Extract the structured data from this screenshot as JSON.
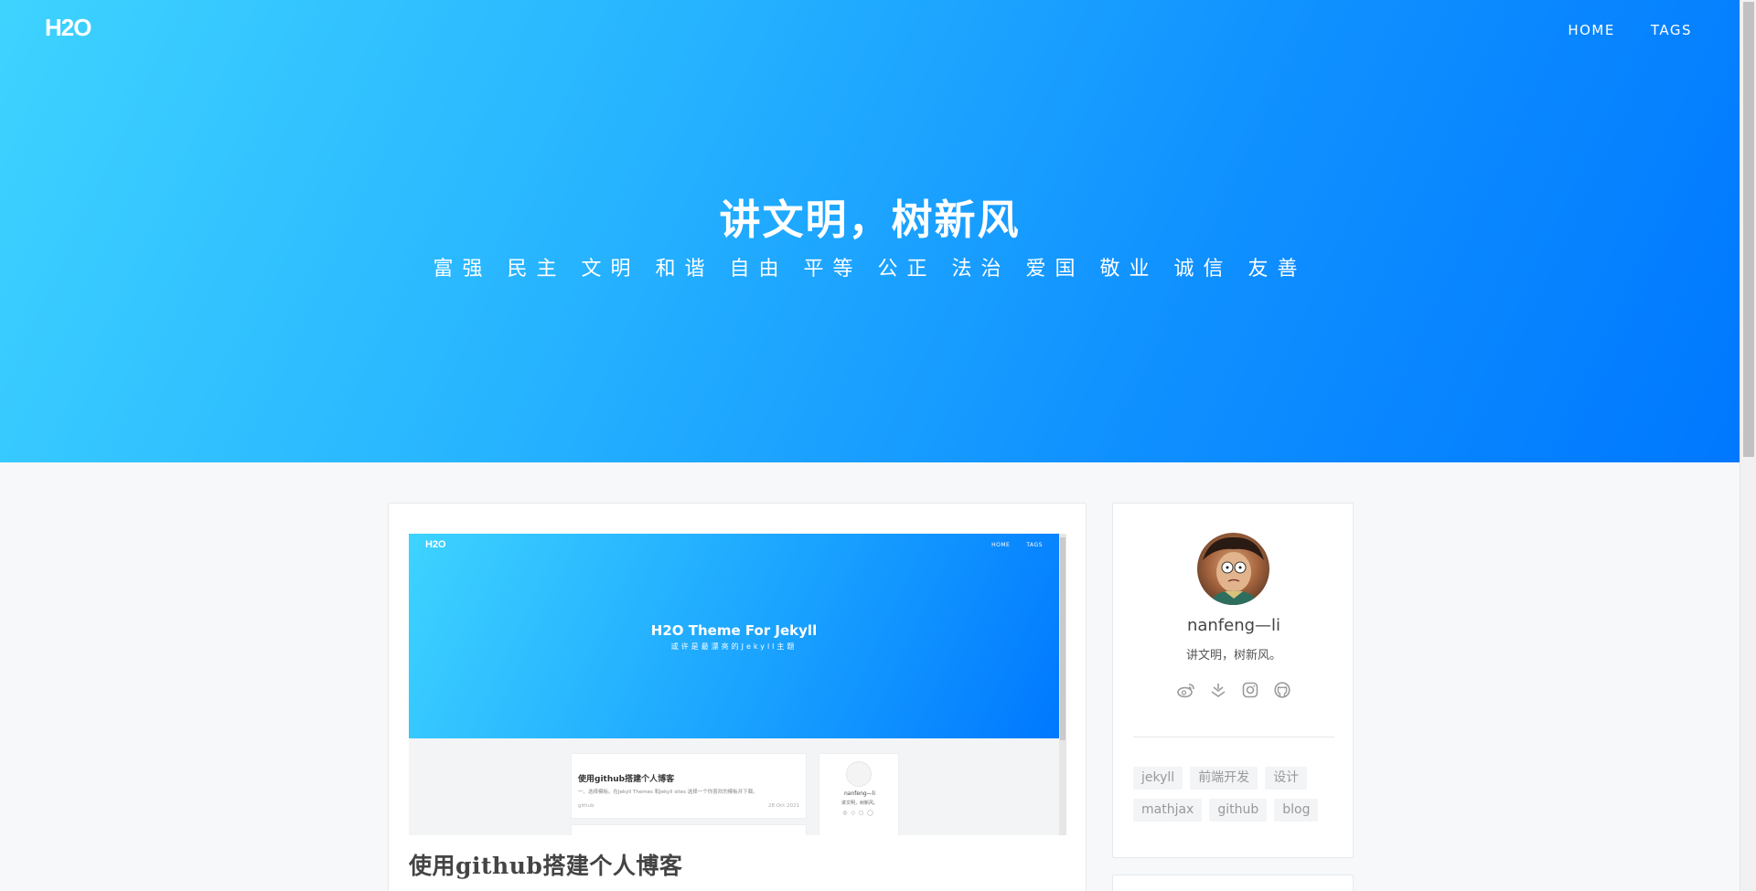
{
  "header": {
    "logo": "H2O",
    "nav": [
      "HOME",
      "TAGS"
    ],
    "title": "讲文明，树新风",
    "subtitle": "富强 民主 文明 和谐 自由 平等 公正 法治 爱国 敬业 诚信 友善"
  },
  "post": {
    "title": "使用github搭建个人博客",
    "thumbnail": {
      "logo": "H2O",
      "nav": [
        "HOME",
        "TAGS"
      ],
      "hero_title": "H2O Theme For Jekyll",
      "hero_subtitle": "或许是最漂亮的Jekyll主题",
      "card_title": "使用github搭建个人博客",
      "card_text": "一、选择模板。在Jekyll Themes 和Jekyll sites 选择一个你喜欢的模板并下载。",
      "card_tag": "github",
      "card_date": "28 Oct 2021",
      "side_name": "nanfeng—li",
      "side_bio": "讲文明，树新风。"
    }
  },
  "sidebar": {
    "name": "nanfeng—li",
    "bio": "讲文明，树新风。",
    "social": [
      "weibo-icon",
      "zhihu-icon",
      "instagram-icon",
      "github-icon"
    ],
    "tags": [
      "jekyll",
      "前端开发",
      "设计",
      "mathjax",
      "github",
      "blog"
    ]
  },
  "colors": {
    "gradient_start": "#3ed3ff",
    "gradient_end": "#0078ff",
    "page_bg": "#f6f8fa",
    "tag_bg": "#f3f4f6"
  }
}
